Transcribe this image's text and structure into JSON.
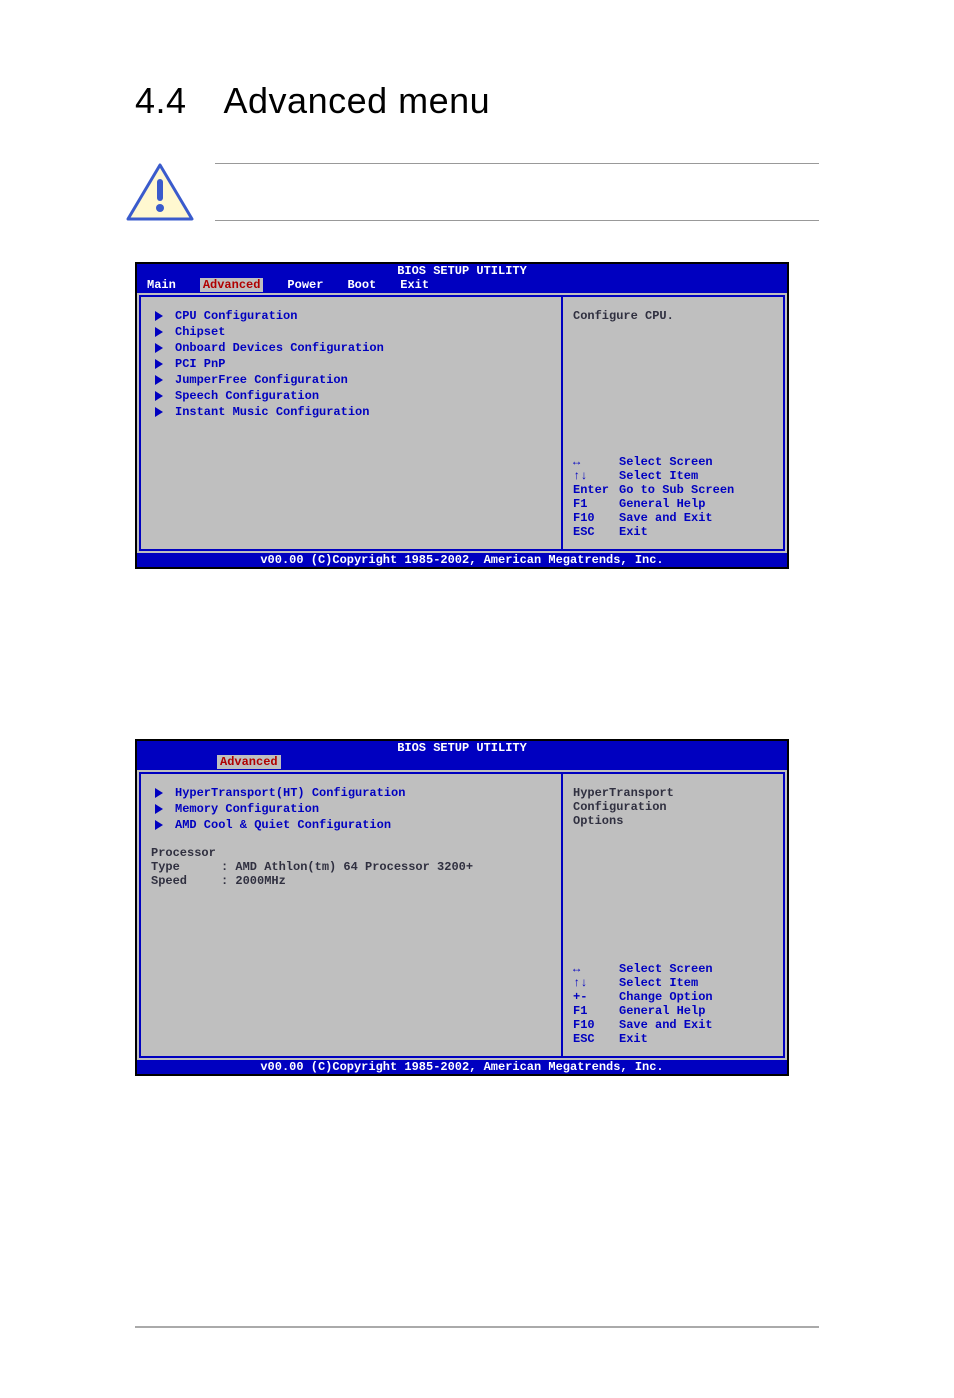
{
  "heading": {
    "num": "4.4",
    "title": "Advanced menu"
  },
  "bios1": {
    "title": "BIOS SETUP UTILITY",
    "tabs": [
      "Main",
      "Advanced",
      "Power",
      "Boot",
      "Exit"
    ],
    "selectedTab": "Advanced",
    "menu": [
      "CPU Configuration",
      "Chipset",
      "Onboard Devices Configuration",
      "PCI PnP",
      "JumperFree Configuration",
      "Speech Configuration",
      "Instant Music Configuration"
    ],
    "helpTop": "Configure CPU.",
    "helpKeys": [
      {
        "key": "↔",
        "label": "Select Screen"
      },
      {
        "key": "↑↓",
        "label": "Select Item"
      },
      {
        "key": "Enter",
        "label": "Go to Sub Screen"
      },
      {
        "key": "F1",
        "label": "General Help"
      },
      {
        "key": "F10",
        "label": "Save and Exit"
      },
      {
        "key": "ESC",
        "label": "Exit"
      }
    ],
    "footer": "v00.00 (C)Copyright 1985-2002, American Megatrends, Inc."
  },
  "bios2": {
    "title": "BIOS SETUP UTILITY",
    "selectedTab": "Advanced",
    "menu": [
      "HyperTransport(HT) Configuration",
      "Memory Configuration",
      "AMD Cool & Quiet Configuration"
    ],
    "info": {
      "processorLabel": "Processor",
      "typeLabel": "Type",
      "typeValue": ": AMD Athlon(tm) 64 Processor 3200+",
      "speedLabel": "Speed",
      "speedValue": ": 2000MHz"
    },
    "helpTopLines": [
      "HyperTransport",
      "Configuration",
      "Options"
    ],
    "helpKeys": [
      {
        "key": "↔",
        "label": "Select Screen"
      },
      {
        "key": "↑↓",
        "label": "Select Item"
      },
      {
        "key": "+-",
        "label": "Change Option"
      },
      {
        "key": "F1",
        "label": "General Help"
      },
      {
        "key": "F10",
        "label": "Save and Exit"
      },
      {
        "key": "ESC",
        "label": "Exit"
      }
    ],
    "footer": "v00.00 (C)Copyright 1985-2002, American Megatrends, Inc."
  }
}
